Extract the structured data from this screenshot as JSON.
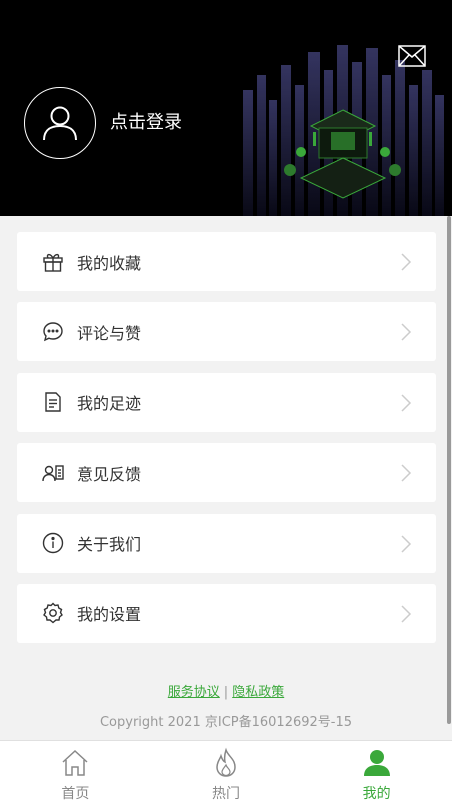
{
  "header": {
    "login_text": "点击登录"
  },
  "menu": [
    {
      "label": "我的收藏",
      "icon": "gift-icon"
    },
    {
      "label": "评论与赞",
      "icon": "comment-icon"
    },
    {
      "label": "我的足迹",
      "icon": "document-icon"
    },
    {
      "label": "意见反馈",
      "icon": "feedback-icon"
    },
    {
      "label": "关于我们",
      "icon": "info-icon"
    },
    {
      "label": "我的设置",
      "icon": "settings-icon"
    }
  ],
  "footer": {
    "service_link": "服务协议",
    "separator": "|",
    "privacy_link": "隐私政策",
    "copyright": "Copyright 2021 京ICP备16012692号-15"
  },
  "tabs": [
    {
      "label": "首页",
      "icon": "home-icon"
    },
    {
      "label": "热门",
      "icon": "flame-icon"
    },
    {
      "label": "我的",
      "icon": "user-icon",
      "active": true
    }
  ],
  "colors": {
    "accent": "#3aa83a",
    "header_bg": "#000000",
    "page_bg": "#f2f2f2"
  }
}
